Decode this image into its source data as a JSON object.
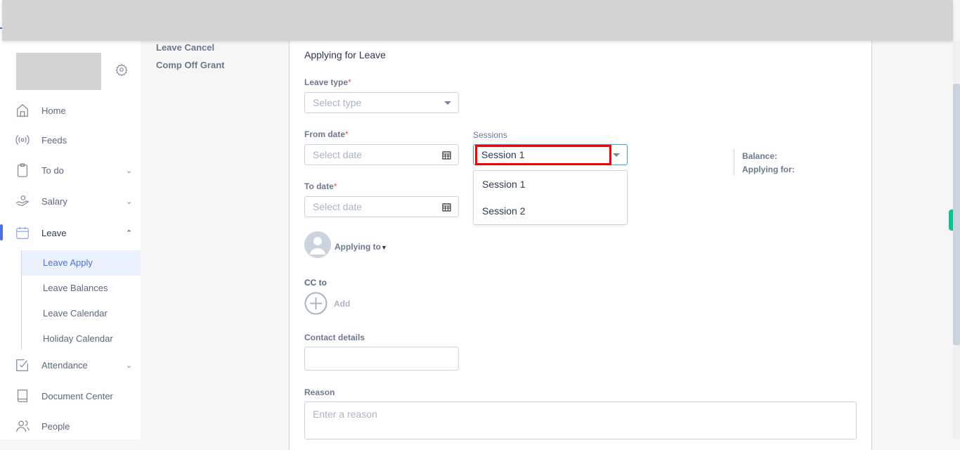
{
  "sidebar": {
    "items": [
      {
        "label": "Home",
        "icon": "home-icon"
      },
      {
        "label": "Feeds",
        "icon": "broadcast-icon"
      },
      {
        "label": "To do",
        "icon": "clipboard-icon"
      },
      {
        "label": "Salary",
        "icon": "hand-money-icon"
      },
      {
        "label": "Leave",
        "icon": "calendar-icon"
      },
      {
        "label": "Attendance",
        "icon": "checkbox-icon"
      },
      {
        "label": "Document Center",
        "icon": "book-icon"
      },
      {
        "label": "People",
        "icon": "people-icon"
      }
    ],
    "leave_sub": [
      "Leave Apply",
      "Leave Balances",
      "Leave Calendar",
      "Holiday Calendar"
    ]
  },
  "mid": {
    "links": [
      "Leave Cancel",
      "Comp Off Grant"
    ]
  },
  "form": {
    "title": "Applying for Leave",
    "leave_type_label": "Leave type",
    "leave_type_placeholder": "Select type",
    "from_label": "From date",
    "from_placeholder": "Select date",
    "to_label": "To date",
    "to_placeholder": "Select date",
    "sessions_label": "Sessions",
    "sessions_value": "Session 1",
    "session_options": [
      "Session 1",
      "Session 2"
    ],
    "required_mark": "*",
    "balance_label": "Balance:",
    "applying_for_label": "Applying for:",
    "applying_to": "Applying to",
    "cc_label": "CC to",
    "add_label": "Add",
    "contact_label": "Contact details",
    "reason_label": "Reason",
    "reason_placeholder": "Enter a reason"
  },
  "colors": {
    "accent": "#4f6fe0",
    "highlight_box": "#ff0000",
    "green_tab": "#0cc28f"
  }
}
